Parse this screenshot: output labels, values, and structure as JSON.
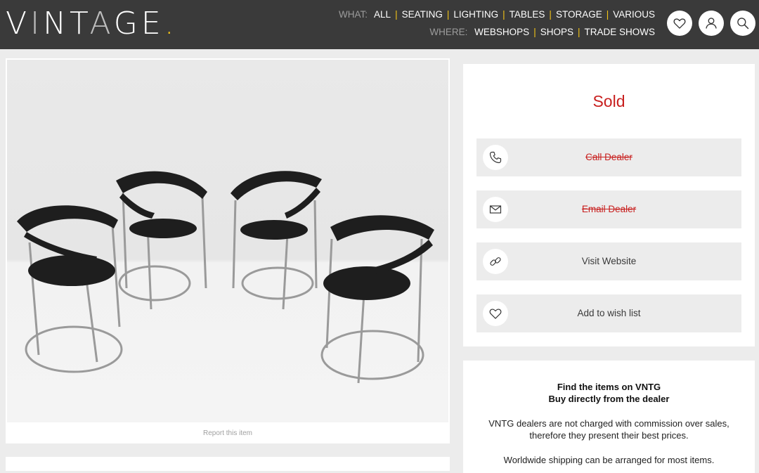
{
  "header": {
    "logo_parts": [
      "V",
      "I",
      "NT",
      "A",
      "GE",
      "."
    ],
    "what_label": "WHAT:",
    "what_items": [
      "ALL",
      "SEATING",
      "LIGHTING",
      "TABLES",
      "STORAGE",
      "VARIOUS"
    ],
    "where_label": "WHERE:",
    "where_items": [
      "WEBSHOPS",
      "SHOPS",
      "TRADE SHOWS"
    ],
    "icons": [
      "heart-icon",
      "user-icon",
      "search-icon"
    ]
  },
  "item": {
    "report_label": "Report this item"
  },
  "panel": {
    "status": "Sold",
    "actions": [
      {
        "label": "Call Dealer",
        "icon": "phone-icon",
        "disabled": true
      },
      {
        "label": "Email Dealer",
        "icon": "envelope-icon",
        "disabled": true
      },
      {
        "label": "Visit Website",
        "icon": "link-icon",
        "disabled": false
      },
      {
        "label": "Add to wish list",
        "icon": "heart-icon",
        "disabled": false
      }
    ]
  },
  "info": {
    "title1": "Find the items on VNTG",
    "title2": "Buy directly from the dealer",
    "para1_line1": "VNTG dealers are not charged with commission over sales,",
    "para1_line2": "therefore they present their best prices.",
    "para2": "Worldwide shipping can be arranged for most items."
  },
  "colors": {
    "header_bg": "#3a3a3a",
    "accent_yellow": "#f2c316",
    "sold_red": "#c8201f",
    "page_bg": "#ececec"
  }
}
